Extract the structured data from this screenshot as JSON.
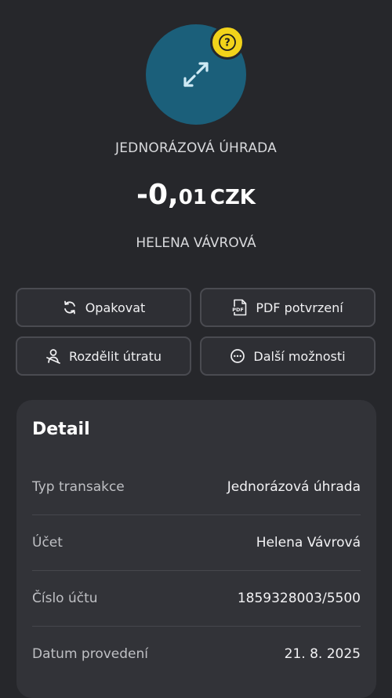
{
  "hero": {
    "transaction_type": "JEDNORÁZOVÁ ÚHRADA",
    "amount_integer": "-0,",
    "amount_decimal": "01",
    "currency": "CZK",
    "counterparty": "HELENA VÁVROVÁ",
    "icon": "transfer-arrows-icon",
    "badge_icon": "question-mark-icon",
    "badge_text": "?",
    "circle_color": "#1b5f7a",
    "badge_color": "#f2d31a"
  },
  "actions": [
    {
      "label": "Opakovat",
      "icon": "repeat-icon"
    },
    {
      "label": "PDF potvrzení",
      "icon": "pdf-icon"
    },
    {
      "label": "Rozdělit útratu",
      "icon": "split-person-icon"
    },
    {
      "label": "Další možnosti",
      "icon": "more-options-icon"
    }
  ],
  "detail": {
    "title": "Detail",
    "rows": [
      {
        "label": "Typ transakce",
        "value": "Jednorázová úhrada"
      },
      {
        "label": "Účet",
        "value": "Helena Vávrová"
      },
      {
        "label": "Číslo účtu",
        "value": "1859328003/5500"
      },
      {
        "label": "Datum provedení",
        "value": "21. 8. 2025"
      }
    ]
  }
}
